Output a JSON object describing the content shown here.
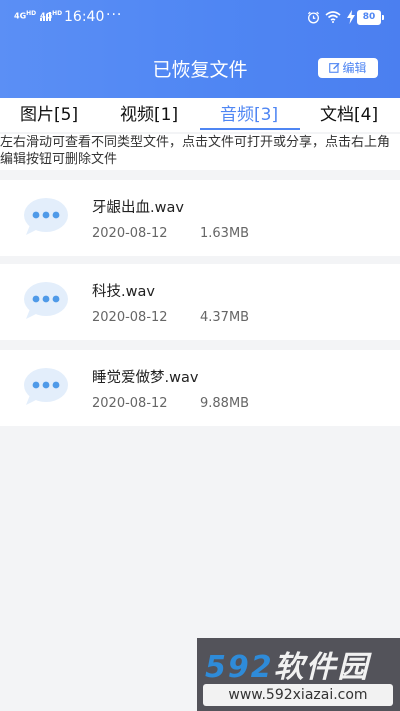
{
  "status_bar": {
    "signal_1": "4G",
    "signal_1_sub": "HD",
    "signal_2": "4G",
    "signal_2_sub": "HD",
    "time": "16:40",
    "more": "···",
    "battery": "80"
  },
  "header": {
    "title": "已恢复文件",
    "edit_label": "编辑"
  },
  "tabs": [
    {
      "label": "图片[5]",
      "active": false
    },
    {
      "label": "视频[1]",
      "active": false
    },
    {
      "label": "音频[3]",
      "active": true
    },
    {
      "label": "文档[4]",
      "active": false
    }
  ],
  "hint": "左右滑动可查看不同类型文件，点击文件可打开或分享，点击右上角编辑按钮可删除文件",
  "files": [
    {
      "name": "牙龈出血.wav",
      "date": "2020-08-12",
      "size": "1.63MB"
    },
    {
      "name": "科技.wav",
      "date": "2020-08-12",
      "size": "4.37MB"
    },
    {
      "name": "睡觉爱做梦.wav",
      "date": "2020-08-12",
      "size": "9.88MB"
    }
  ],
  "watermark": {
    "brand_num": "592",
    "brand_cn": "软件园",
    "url": "www.592xiazai.com"
  },
  "colors": {
    "accent": "#4f86f3",
    "bubble": "#e3eefb",
    "bubble_dot": "#4f9ae8"
  }
}
